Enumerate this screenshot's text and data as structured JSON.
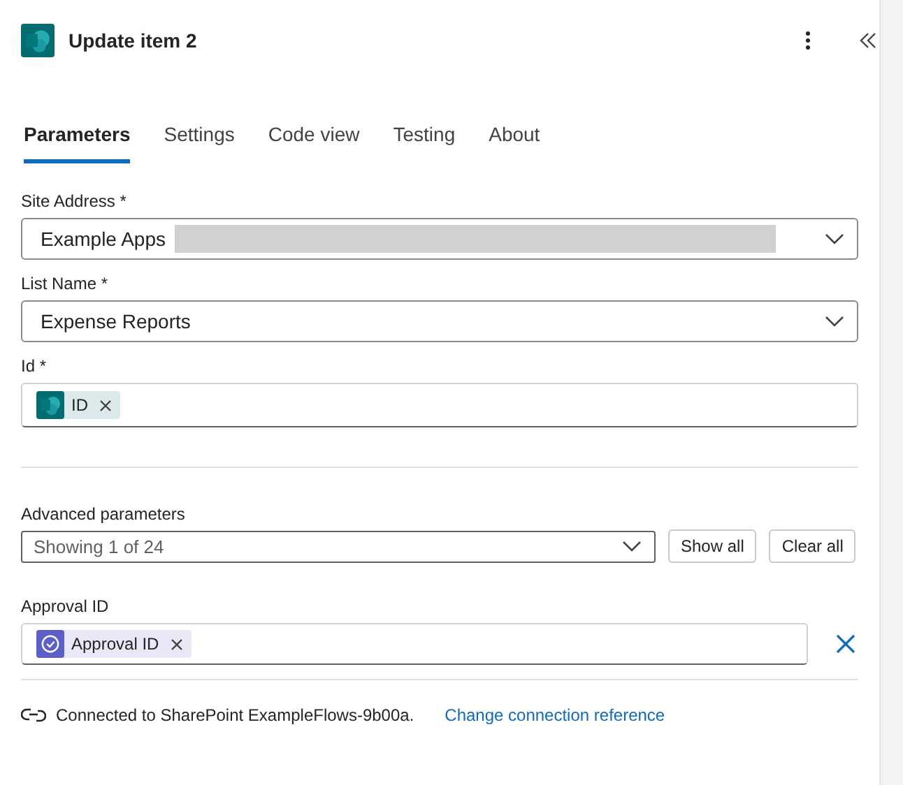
{
  "header": {
    "title": "Update item 2"
  },
  "tabs": [
    {
      "label": "Parameters",
      "selected": true
    },
    {
      "label": "Settings",
      "selected": false
    },
    {
      "label": "Code view",
      "selected": false
    },
    {
      "label": "Testing",
      "selected": false
    },
    {
      "label": "About",
      "selected": false
    }
  ],
  "fields": [
    {
      "label": "Site Address *",
      "kind": "dropdown",
      "value": "Example Apps",
      "redacted": true
    },
    {
      "label": "List Name *",
      "kind": "dropdown",
      "value": "Expense Reports",
      "redacted": false
    },
    {
      "label": "Id *",
      "kind": "token",
      "token": {
        "label": "ID",
        "kind": "sharepoint",
        "color": "#036c70"
      }
    }
  ],
  "advanced": {
    "label": "Advanced parameters",
    "value": "Showing 1 of 24",
    "buttons": [
      "Show all",
      "Clear all"
    ]
  },
  "extra_fields": [
    {
      "label": "Approval ID",
      "kind": "token",
      "removable": true,
      "token": {
        "label": "Approval ID",
        "kind": "approval",
        "color": "#5b5fc7"
      }
    }
  ],
  "footer": {
    "text": "Connected to SharePoint ExampleFlows-9b00a.",
    "link": "Change connection reference"
  }
}
